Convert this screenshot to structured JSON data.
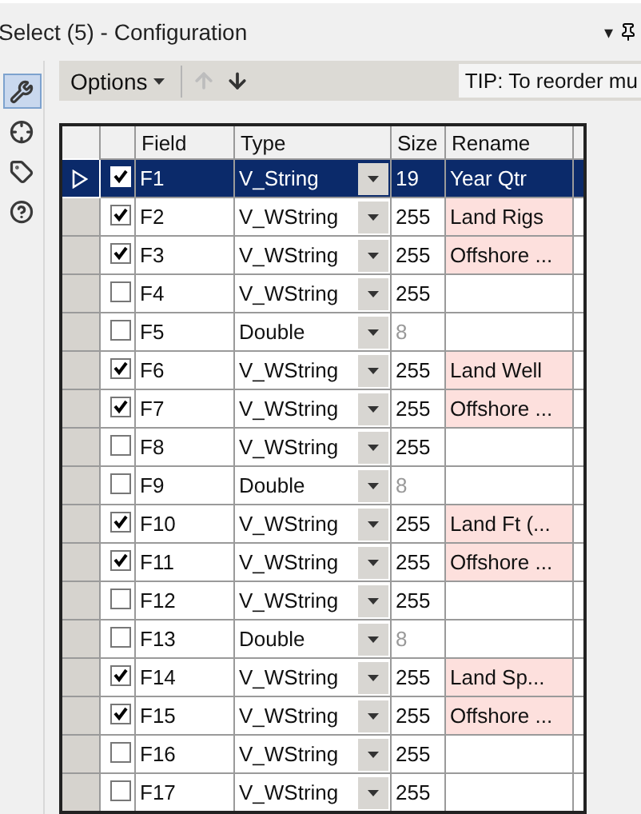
{
  "window": {
    "title": "Select (5) - Configuration",
    "controls": [
      "▾"
    ]
  },
  "toolbar": {
    "options_label": "Options",
    "tip": "TIP: To reorder mu"
  },
  "sidebar": {
    "items": [
      {
        "kind": "wrench",
        "selected": true
      },
      {
        "kind": "target",
        "selected": false
      },
      {
        "kind": "tag",
        "selected": false
      },
      {
        "kind": "help",
        "selected": false
      }
    ]
  },
  "table": {
    "columns": [
      "Field",
      "Type",
      "Size",
      "Rename"
    ],
    "rows": [
      {
        "checked": true,
        "field": "F1",
        "type": "V_String",
        "size": "19",
        "size_disabled": false,
        "rename": "Year Qtr",
        "selected": true
      },
      {
        "checked": true,
        "field": "F2",
        "type": "V_WString",
        "size": "255",
        "size_disabled": false,
        "rename": "Land Rigs",
        "selected": false
      },
      {
        "checked": true,
        "field": "F3",
        "type": "V_WString",
        "size": "255",
        "size_disabled": false,
        "rename": "Offshore ...",
        "selected": false
      },
      {
        "checked": false,
        "field": "F4",
        "type": "V_WString",
        "size": "255",
        "size_disabled": false,
        "selected": false
      },
      {
        "checked": false,
        "field": "F5",
        "type": "Double",
        "size": "8",
        "size_disabled": true,
        "selected": false
      },
      {
        "checked": true,
        "field": "F6",
        "type": "V_WString",
        "size": "255",
        "size_disabled": false,
        "rename": "Land Well",
        "selected": false
      },
      {
        "checked": true,
        "field": "F7",
        "type": "V_WString",
        "size": "255",
        "size_disabled": false,
        "rename": "Offshore ...",
        "selected": false
      },
      {
        "checked": false,
        "field": "F8",
        "type": "V_WString",
        "size": "255",
        "size_disabled": false,
        "selected": false
      },
      {
        "checked": false,
        "field": "F9",
        "type": "Double",
        "size": "8",
        "size_disabled": true,
        "selected": false
      },
      {
        "checked": true,
        "field": "F10",
        "type": "V_WString",
        "size": "255",
        "size_disabled": false,
        "rename": "Land Ft (...",
        "selected": false
      },
      {
        "checked": true,
        "field": "F11",
        "type": "V_WString",
        "size": "255",
        "size_disabled": false,
        "rename": "Offshore ...",
        "selected": false
      },
      {
        "checked": false,
        "field": "F12",
        "type": "V_WString",
        "size": "255",
        "size_disabled": false,
        "selected": false
      },
      {
        "checked": false,
        "field": "F13",
        "type": "Double",
        "size": "8",
        "size_disabled": true,
        "selected": false
      },
      {
        "checked": true,
        "field": "F14",
        "type": "V_WString",
        "size": "255",
        "size_disabled": false,
        "rename": "Land Sp...",
        "selected": false
      },
      {
        "checked": true,
        "field": "F15",
        "type": "V_WString",
        "size": "255",
        "size_disabled": false,
        "rename": "Offshore ...",
        "selected": false
      },
      {
        "checked": false,
        "field": "F16",
        "type": "V_WString",
        "size": "255",
        "size_disabled": false,
        "selected": false
      },
      {
        "checked": false,
        "field": "F17",
        "type": "V_WString",
        "size": "255",
        "size_disabled": false,
        "selected": false
      }
    ]
  }
}
